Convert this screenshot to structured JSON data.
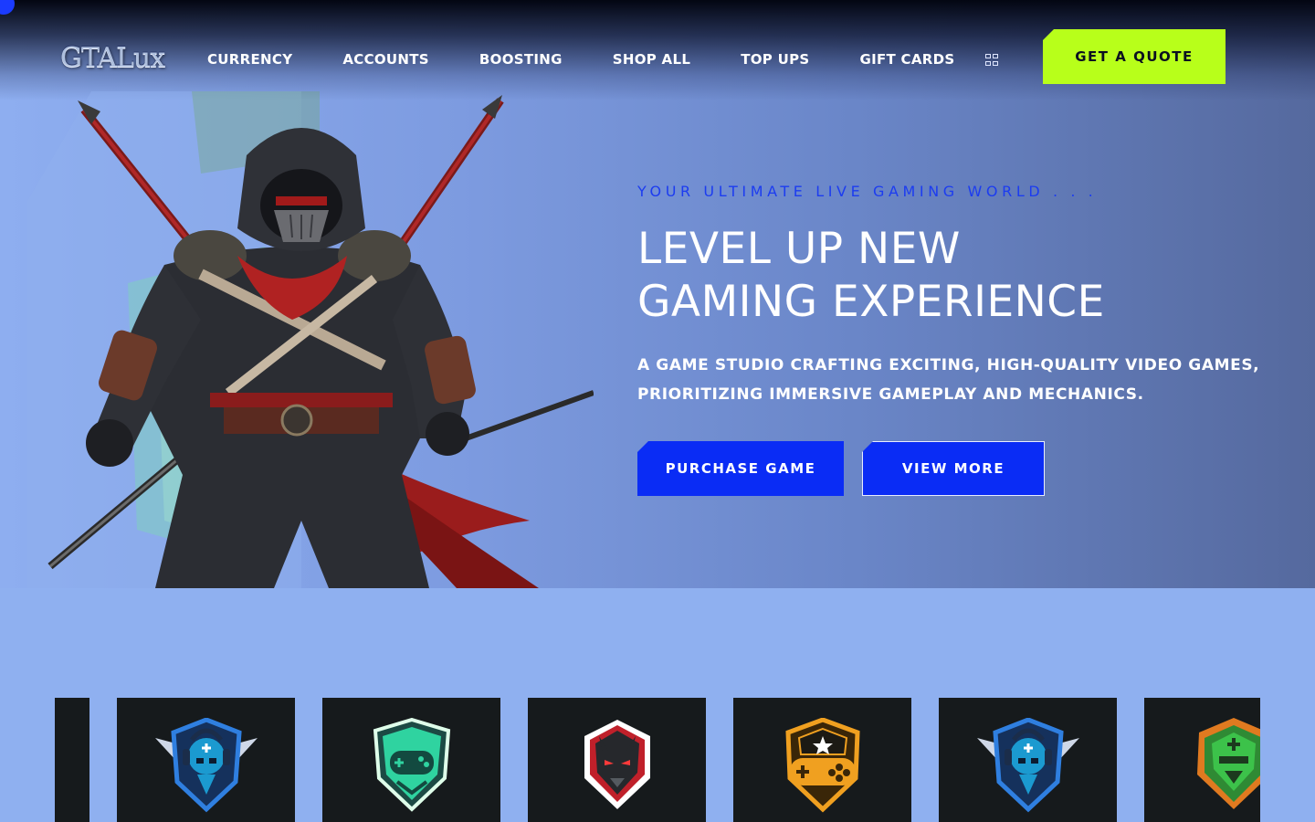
{
  "brand": {
    "logo_text": "GTALux",
    "accent_color": "#b8ff1a",
    "primary_blue": "#0a2cf5"
  },
  "nav": {
    "links": [
      {
        "label": "CURRENCY"
      },
      {
        "label": "ACCOUNTS"
      },
      {
        "label": "BOOSTING"
      },
      {
        "label": "SHOP ALL"
      },
      {
        "label": "TOP UPS"
      },
      {
        "label": "GIFT CARDS"
      }
    ],
    "menu_icon": "grid-icon",
    "cta_label": "GET A QUOTE"
  },
  "hero": {
    "tagline": "YOUR ULTIMATE LIVE GAMING WORLD . . .",
    "headline_line1": "LEVEL UP NEW",
    "headline_line2": "GAMING EXPERIENCE",
    "description": "A GAME STUDIO CRAFTING EXCITING, HIGH-QUALITY VIDEO GAMES, PRIORITIZING IMMERSIVE GAMEPLAY AND MECHANICS.",
    "image": "hooded-ninja-warrior-with-swords",
    "primary_button": "PURCHASE GAME",
    "secondary_button": "VIEW MORE"
  },
  "game_cards": [
    {
      "icon": "blue-winged-skull-emblem-icon",
      "color": "#2f7fe0"
    },
    {
      "icon": "green-gamepad-shield-emblem-icon",
      "color": "#2fd3a0"
    },
    {
      "icon": "red-demon-mask-emblem-icon",
      "color": "#e03b3b"
    },
    {
      "icon": "orange-gamepad-star-emblem-icon",
      "color": "#f0a020"
    },
    {
      "icon": "blue-winged-skull-emblem-icon",
      "color": "#2f7fe0"
    },
    {
      "icon": "green-warrior-helmet-emblem-icon",
      "color": "#3cc24a"
    }
  ]
}
